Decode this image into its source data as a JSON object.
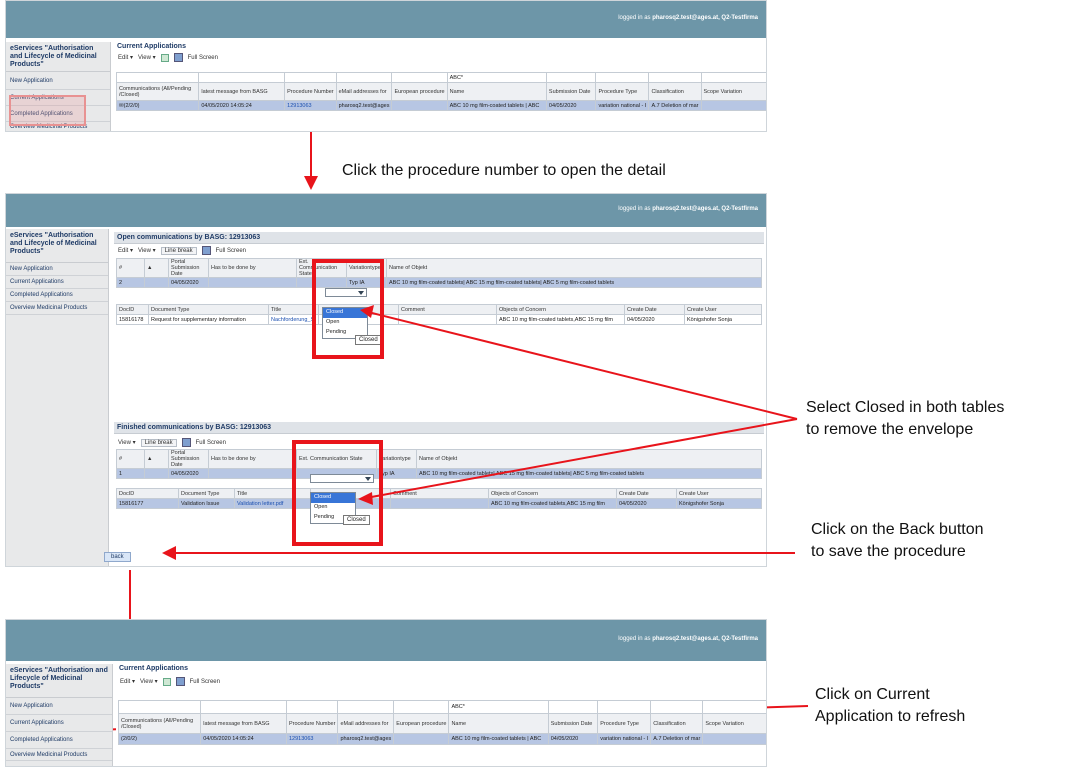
{
  "header": {
    "logged_prefix": "logged in as",
    "logged_user": "pharosq2.test@ages.at, Q2-Testfirma"
  },
  "sidebar": {
    "title": "eServices \"Authorisation and Lifecycle of Medicinal Products\"",
    "items": [
      "New Application",
      "Current Applications",
      "Completed Applications",
      "Overview Medicinal Products"
    ]
  },
  "toolbar": {
    "edit": "Edit ▾",
    "view": "View ▾",
    "full_screen": "Full Screen",
    "line_break": "Line break"
  },
  "current": {
    "title": "Current Applications",
    "filter_value": "ABC*",
    "headers": [
      "Communications (All/Pending /Closed)",
      "latest message from BASG",
      "Procedure Number",
      "eMail addresses for",
      "European procedure",
      "Name",
      "Submission Date",
      "Procedure Type",
      "Classification",
      "Scope Variation"
    ],
    "row_before": [
      "(2/2/0)",
      "04/05/2020 14:05:24",
      "12913063",
      "pharosq2.test@ages",
      "",
      "ABC 10 mg film-coated tablets | ABC",
      "04/05/2020",
      "variation national - I",
      "A.7 Deletion of mar",
      ""
    ],
    "row_after": [
      "(2/0/2)",
      "04/05/2020 14:05:24",
      "12913063",
      "pharosq2.test@ages",
      "",
      "ABC 10 mg film-coated tablets | ABC",
      "04/05/2020",
      "variation national - I",
      "A.7 Deletion of mar",
      ""
    ]
  },
  "open_comm": {
    "title": "Open communications by BASG: 12913063",
    "headers": [
      "#",
      "",
      "Portal Submission Date",
      "Has to be done by",
      "Ext. Communication State",
      "Variationtype",
      "Name of Objekt"
    ],
    "row": [
      "2",
      "",
      "04/05/2020",
      "",
      "",
      "Typ IA",
      "ABC 10 mg film-coated tablets| ABC 15 mg film-coated tablets| ABC 5 mg film-coated tablets"
    ],
    "doc_headers": [
      "DocID",
      "Document Type",
      "Title",
      "",
      "Comment",
      "Objects of Concern",
      "Create Date",
      "Create User"
    ],
    "doc_row": [
      "15816178",
      "Request for supplementary information",
      "Nachforderung_S",
      "",
      "",
      "ABC 10 mg film-coated tablets,ABC 15 mg film",
      "04/05/2020",
      "Königshofer Sonja"
    ]
  },
  "finished_comm": {
    "title": "Finished communications by BASG: 12913063",
    "headers": [
      "#",
      "",
      "Portal Submission Date",
      "Has to be done by",
      "Ext. Communication State",
      "Variationtype",
      "Name of Objekt"
    ],
    "row": [
      "1",
      "",
      "04/05/2020",
      "",
      "",
      "Typ IA",
      "ABC 10 mg film-coated tablets| ABC 15 mg film-coated tablets| ABC 5 mg film-coated tablets"
    ],
    "doc_headers": [
      "DocID",
      "Document Type",
      "Title",
      "",
      "Comment",
      "Objects of Concern",
      "Create Date",
      "Create User"
    ],
    "doc_row": [
      "15816177",
      "Validation Issue",
      "Validation letter.pdf",
      "",
      "",
      "ABC 10 mg film-coated tablets,ABC 15 mg film",
      "04/05/2020",
      "Königshofer Sonja"
    ]
  },
  "dropdown": {
    "options": [
      "Closed",
      "Open",
      "Pending"
    ],
    "tooltip": "Closed"
  },
  "back_button": "back",
  "annotations": {
    "step1": "Click the procedure number to open the detail",
    "step2_l1": "Select Closed in both tables",
    "step2_l2": "to remove the envelope",
    "step3_l1": "Click on the Back button",
    "step3_l2": "to save the procedure",
    "step4_l1": "Click on Current",
    "step4_l2": "Application to refresh"
  },
  "colors": {
    "header_bar": "#6d96a8",
    "highlight_red": "#e8141b",
    "selected_row": "#b7c6e3"
  }
}
